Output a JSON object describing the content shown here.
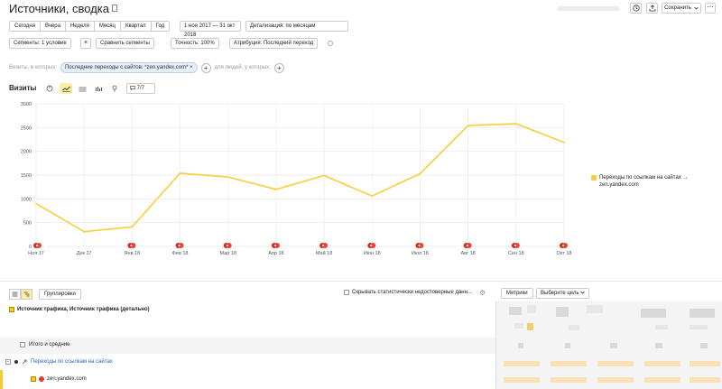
{
  "header": {
    "title": "Источники, сводка",
    "save_label": "Сохранить",
    "more_label": "⋯"
  },
  "period_tabs": [
    "Сегодня",
    "Вчера",
    "Неделя",
    "Месяц",
    "Квартал",
    "Год"
  ],
  "date_range": "1 ноя 2017 — 31 окт 2018",
  "detail": "Детализация: по месяцам",
  "segment_bar": {
    "segment": "Сегменты: 1 условие",
    "compare": "Сравнить сегменты",
    "accuracy": "Точность: 100%",
    "attribution": "Атрибуция: Последний переход"
  },
  "filters": {
    "prefix": "Визиты, в которых:",
    "chip": "Последние переходы с сайтов: *zen.yandex.com*",
    "suffix": "для людей, у которых:"
  },
  "chart_header": {
    "label": "Визиты",
    "goals": "7/7"
  },
  "chart_data": {
    "type": "line",
    "categories": [
      "Ноя 17",
      "Дек 17",
      "Янв 18",
      "Фев 18",
      "Мар 18",
      "Апр 18",
      "Май 18",
      "Июн 18",
      "Июл 18",
      "Авг 18",
      "Сен 18",
      "Окт 18"
    ],
    "y_ticks": [
      "0",
      "500",
      "1000",
      "1500",
      "2000",
      "2500",
      "3000"
    ],
    "ylim": [
      0,
      3000
    ],
    "series": [
      {
        "name": "Переходы по ссылкам на сайтах → zen.yandex.com",
        "color": "#f8ce3a",
        "values": [
          900,
          310,
          410,
          1540,
          1460,
          1200,
          1490,
          1060,
          1530,
          2540,
          2580,
          2190
        ]
      }
    ],
    "grid": true,
    "legend": "right"
  },
  "legend_label": "Переходы по ссылкам на сайтах → zen.yandex.com",
  "table_toolbar": {
    "group_label": "Группировки",
    "hide_label": "Скрывать статистически недостоверные данн...",
    "metrics_label": "Метрики",
    "goal_label": "Выберите цель"
  },
  "table": {
    "dimension_header": "Источник трафика, Источник трафика (детально)",
    "totals_label": "Итого и средние",
    "row1_label": "Переходы по ссылкам на сайтах",
    "row2_label": "zen.yandex.com"
  }
}
